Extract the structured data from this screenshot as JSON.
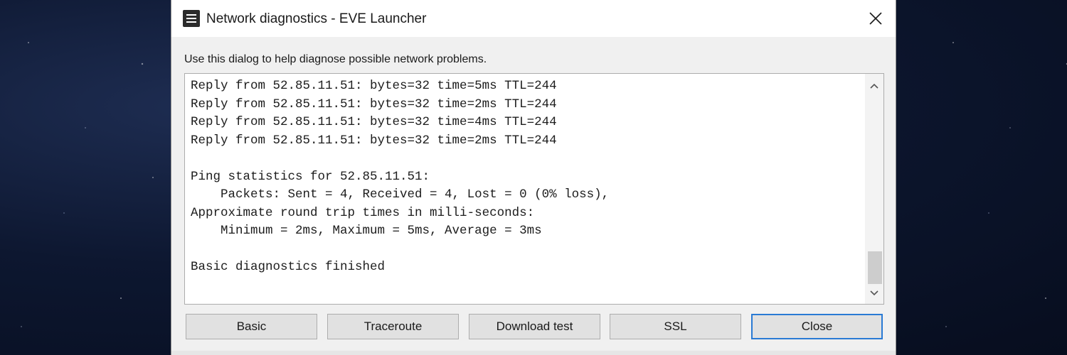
{
  "window": {
    "title": "Network diagnostics - EVE Launcher",
    "icon": "app-menu-icon",
    "close_icon": "close-icon"
  },
  "description": "Use this dialog to help diagnose possible network problems.",
  "output": {
    "lines": [
      "Reply from 52.85.11.51: bytes=32 time=5ms TTL=244",
      "Reply from 52.85.11.51: bytes=32 time=2ms TTL=244",
      "Reply from 52.85.11.51: bytes=32 time=4ms TTL=244",
      "Reply from 52.85.11.51: bytes=32 time=2ms TTL=244",
      "",
      "Ping statistics for 52.85.11.51:",
      "    Packets: Sent = 4, Received = 4, Lost = 0 (0% loss),",
      "Approximate round trip times in milli-seconds:",
      "    Minimum = 2ms, Maximum = 5ms, Average = 3ms",
      "",
      "Basic diagnostics finished"
    ]
  },
  "buttons": {
    "basic": "Basic",
    "traceroute": "Traceroute",
    "download_test": "Download test",
    "ssl": "SSL",
    "close": "Close"
  },
  "colors": {
    "dialog_bg": "#f0f0f0",
    "default_button_border": "#2a7ad4",
    "background": "#0d1730"
  }
}
